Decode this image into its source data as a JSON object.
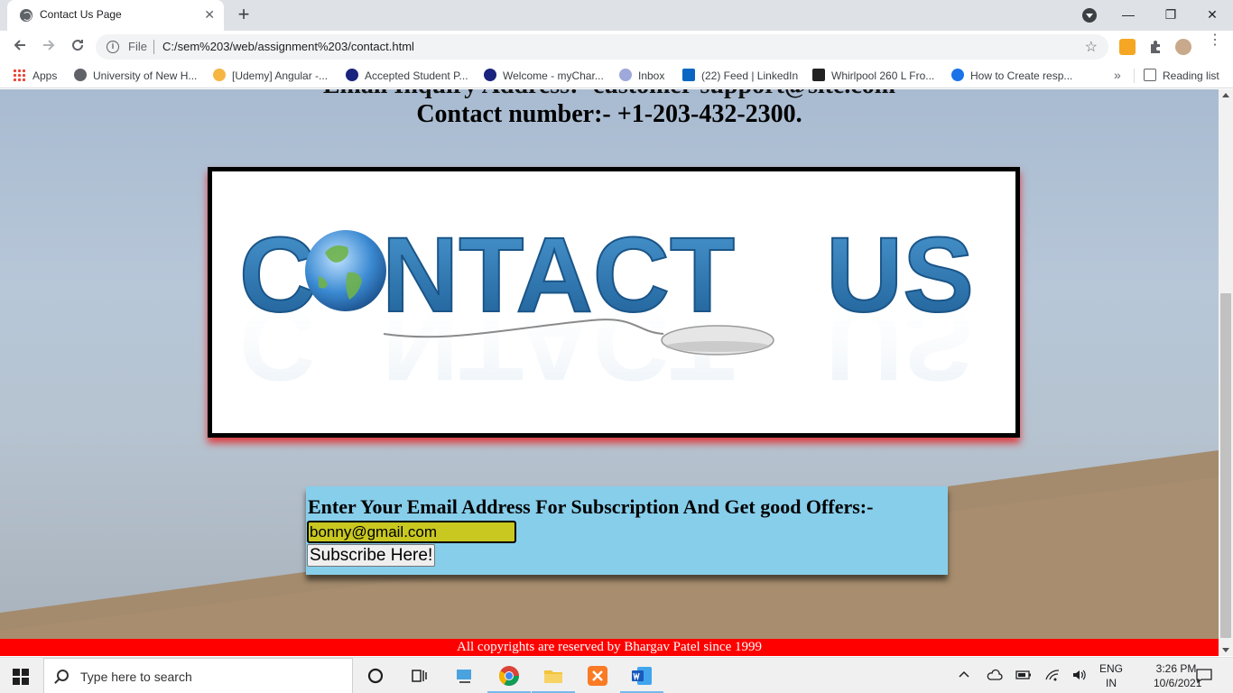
{
  "browser": {
    "tab_title": "Contact Us Page",
    "tab_close": "✕",
    "new_tab": "+",
    "window": {
      "minimize": "—",
      "maximize": "❐",
      "close": "✕"
    },
    "address": {
      "file_label": "File",
      "url": "C:/sem%203/web/assignment%203/contact.html"
    },
    "bookmarks": [
      {
        "label": "Apps"
      },
      {
        "label": "University of New H..."
      },
      {
        "label": "[Udemy] Angular -..."
      },
      {
        "label": "Accepted Student P..."
      },
      {
        "label": "Welcome - myChar..."
      },
      {
        "label": "Inbox"
      },
      {
        "label": "(22) Feed | LinkedIn"
      },
      {
        "label": "Whirlpool 260 L Fro..."
      },
      {
        "label": "How to Create resp..."
      }
    ],
    "bookmarks_more": "»",
    "reading_list": "Reading list"
  },
  "page": {
    "partial_line": "Email Inquiry Address:- customer-support@site.com",
    "contact_number": "Contact number:- +1-203-432-2300.",
    "banner": {
      "text_left": "C",
      "text_mid": "NTACT",
      "text_right": "US"
    },
    "subscribe": {
      "heading": "Enter Your Email Address For Subscription And Get good Offers:-",
      "email_value": "bonny@gmail.com",
      "button_label": "Subscribe Here!"
    },
    "footer": "All copyrights are reserved by Bhargav Patel since 1999"
  },
  "taskbar": {
    "search_placeholder": "Type here to search",
    "lang_top": "ENG",
    "lang_bottom": "IN",
    "time": "3:26 PM",
    "date": "10/6/2021"
  },
  "colors": {
    "page_background": "#b4c4d6",
    "subscribe_box": "#87ceeb",
    "email_field": "#c8c820",
    "footer": "#ff0000",
    "banner_text": "#2f7ab9"
  }
}
